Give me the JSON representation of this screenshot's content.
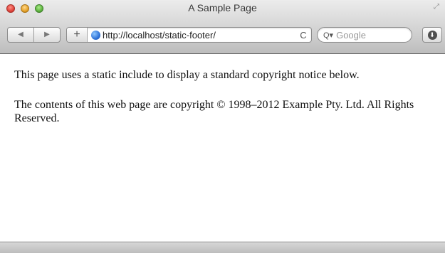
{
  "window": {
    "title": "A Sample Page"
  },
  "toolbar": {
    "back_icon": "◀",
    "forward_icon": "▶",
    "add_icon": "+",
    "url": "http://localhost/static-footer/",
    "reload_icon": "C",
    "search_placeholder": "Google",
    "search_icon": "Q▾",
    "download_icon": "⬇"
  },
  "page": {
    "paragraphs": [
      "This page uses a static include to display a standard copyright notice below.",
      "The contents of this web page are copyright © 1998–2012 Example Pty. Ltd. All Rights Reserved."
    ]
  },
  "colors": {
    "close": "#e0443b",
    "minimize": "#e5a22a",
    "maximize": "#5fb340",
    "chrome": "#d3d3d3"
  }
}
